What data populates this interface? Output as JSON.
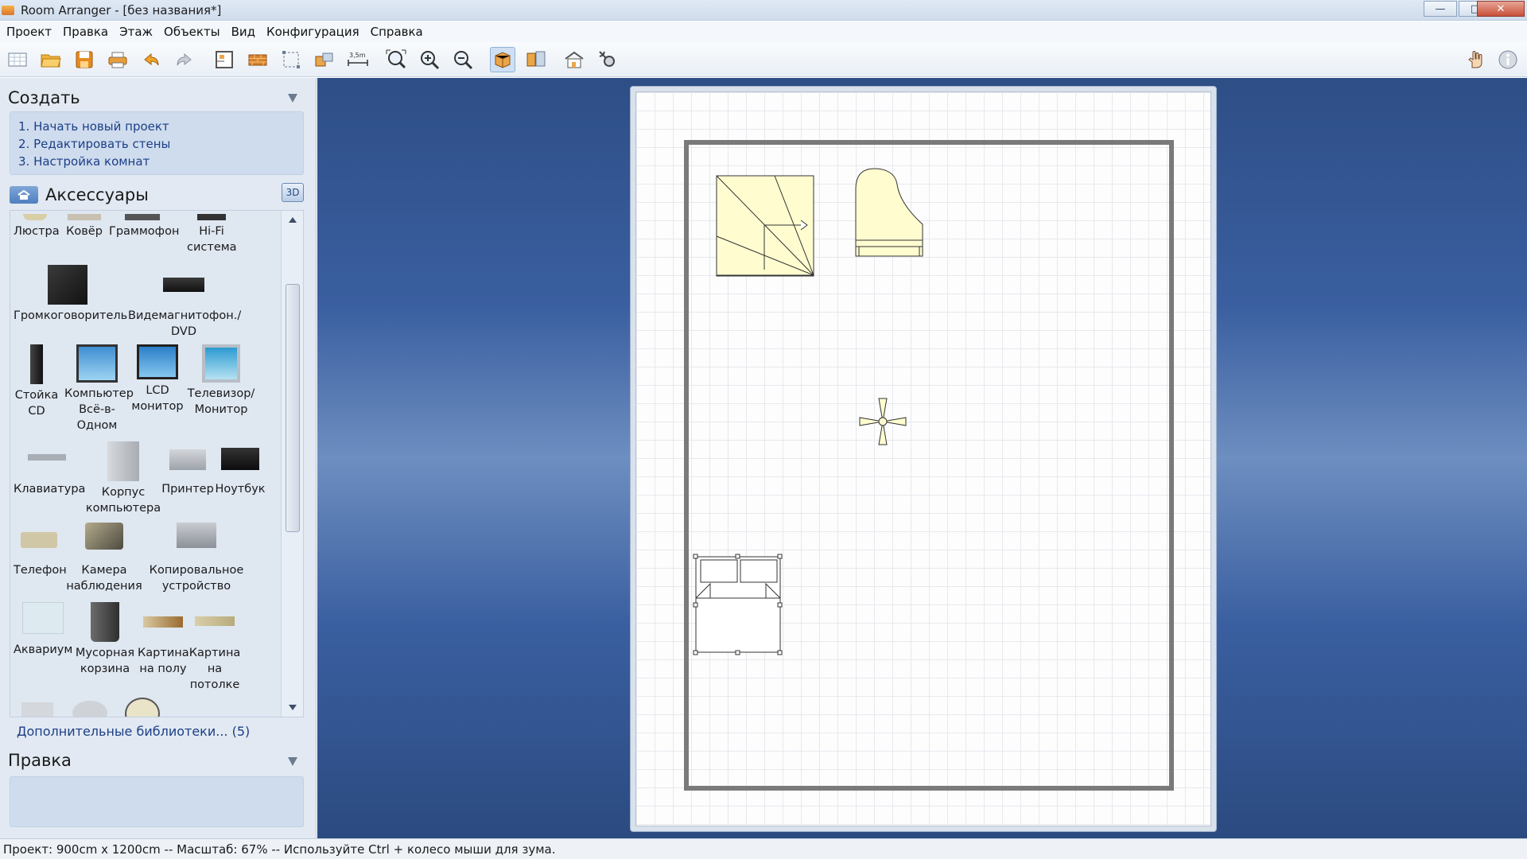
{
  "window": {
    "title": "Room Arranger - [без названия*]",
    "minimize_glyph": "—",
    "maximize_glyph": "□",
    "close_glyph": "✕"
  },
  "menu": [
    "Проект",
    "Правка",
    "Этаж",
    "Объекты",
    "Вид",
    "Конфигурация",
    "Справка"
  ],
  "toolbar_icons": [
    "new-project-icon",
    "open-folder-icon",
    "save-icon",
    "print-icon",
    "undo-icon",
    "redo-icon",
    "room-plan-icon",
    "wall-icon",
    "select-area-icon",
    "objects-icon",
    "measure-icon",
    "zoom-fit-icon",
    "zoom-in-icon",
    "zoom-out-icon",
    "3d-box-icon",
    "library-icon",
    "house-3d-icon",
    "settings-icon",
    "hand-icon",
    "info-icon"
  ],
  "measure_label": "3,5m",
  "sidebar": {
    "create_title": "Создать",
    "steps": [
      "1. Начать новый проект",
      "2. Редактировать стены",
      "3. Настройка комнат"
    ],
    "category_title": "Аксессуары",
    "btn_3d": "3D",
    "items": [
      {
        "label": "Люстра"
      },
      {
        "label": "Ковёр"
      },
      {
        "label": "Граммофон"
      },
      {
        "label": "Hi-Fi\nсистема"
      },
      {
        "label": "Громкоговоритель"
      },
      {
        "label": "Видемагнитофон./\nDVD"
      },
      {
        "label": "Стойка\nCD"
      },
      {
        "label": "Компьютер\nВсё-в-\nОдном"
      },
      {
        "label": "LCD\nмонитор"
      },
      {
        "label": "Телевизор/\nМонитор"
      },
      {
        "label": "Клавиатура"
      },
      {
        "label": "Корпус\nкомпьютера"
      },
      {
        "label": "Принтер"
      },
      {
        "label": "Ноутбук"
      },
      {
        "label": "Телефон"
      },
      {
        "label": "Камера\nнаблюдения"
      },
      {
        "label": "Копировальное\nустройство"
      },
      {
        "label": "Аквариум"
      },
      {
        "label": "Мусорная\nкорзина"
      },
      {
        "label": "Картина\nна полу"
      },
      {
        "label": "Картина\nна\nпотолке"
      }
    ],
    "more_libraries": "Дополнительные библиотеки... (5)",
    "edit_title": "Правка"
  },
  "status": "Проект: 900cm x 1200cm -- Масштаб: 67% -- Используйте Ctrl + колесо мыши для зума."
}
